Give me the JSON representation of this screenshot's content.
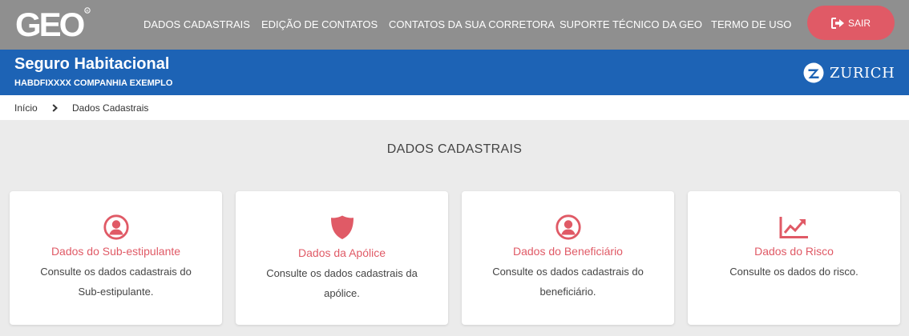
{
  "header": {
    "logo_text": "GEO",
    "nav": [
      "DADOS CADASTRAIS",
      "EDIÇÃO DE CONTATOS",
      "CONTATOS DA SUA CORRETORA",
      "SUPORTE TÉCNICO DA GEO",
      "TERMO DE USO"
    ],
    "logout_label": "SAIR"
  },
  "banner": {
    "title": "Seguro Habitacional",
    "policy_code": "HABDFIXXXX",
    "company": "COMPANHIA EXEMPLO",
    "brand": "ZURICH"
  },
  "breadcrumb": [
    "Início",
    "Dados Cadastrais"
  ],
  "page": {
    "title": "DADOS CADASTRAIS"
  },
  "cards": [
    {
      "icon": "user-circle-icon",
      "title": "Dados do Sub-estipulante",
      "description": "Consulte os dados cadastrais do Sub-estipulante."
    },
    {
      "icon": "shield-icon",
      "title": "Dados da Apólice",
      "description": "Consulte os dados cadastrais da apólice."
    },
    {
      "icon": "user-circle-icon",
      "title": "Dados do Beneficiário",
      "description": "Consulte os dados cadastrais do beneficiário."
    },
    {
      "icon": "trend-chart-icon",
      "title": "Dados do Risco",
      "description": "Consulte os dados do risco."
    }
  ],
  "colors": {
    "topbar": "#8f8f8f",
    "banner": "#1d63b5",
    "accent": "#e05a66",
    "background": "#ebebeb"
  }
}
